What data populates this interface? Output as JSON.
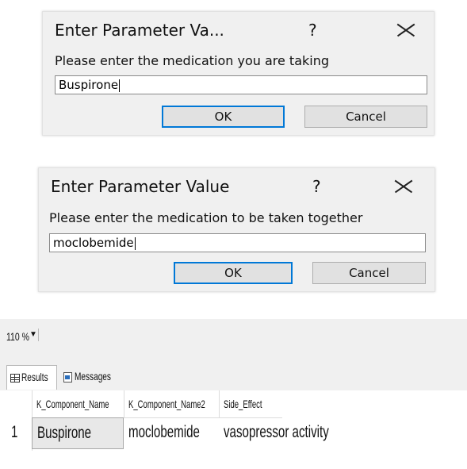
{
  "dialog1": {
    "title": "Enter Parameter Va...",
    "help": "?",
    "prompt": "Please enter the medication you are taking",
    "value": "Buspirone",
    "ok_label": "OK",
    "cancel_label": "Cancel"
  },
  "dialog2": {
    "title": "Enter Parameter Value",
    "help": "?",
    "prompt": "Please enter the medication to be taken together",
    "value": "moclobemide",
    "ok_label": "OK",
    "cancel_label": "Cancel"
  },
  "results": {
    "zoom": "110 %",
    "tabs": [
      "Results",
      "Messages"
    ],
    "columns": [
      "K_Component_Name",
      "K_Component_Name2",
      "Side_Effect"
    ],
    "rows": [
      {
        "num": "1",
        "cells": [
          "Buspirone",
          "moclobemide",
          "vasopressor activity"
        ]
      }
    ]
  }
}
